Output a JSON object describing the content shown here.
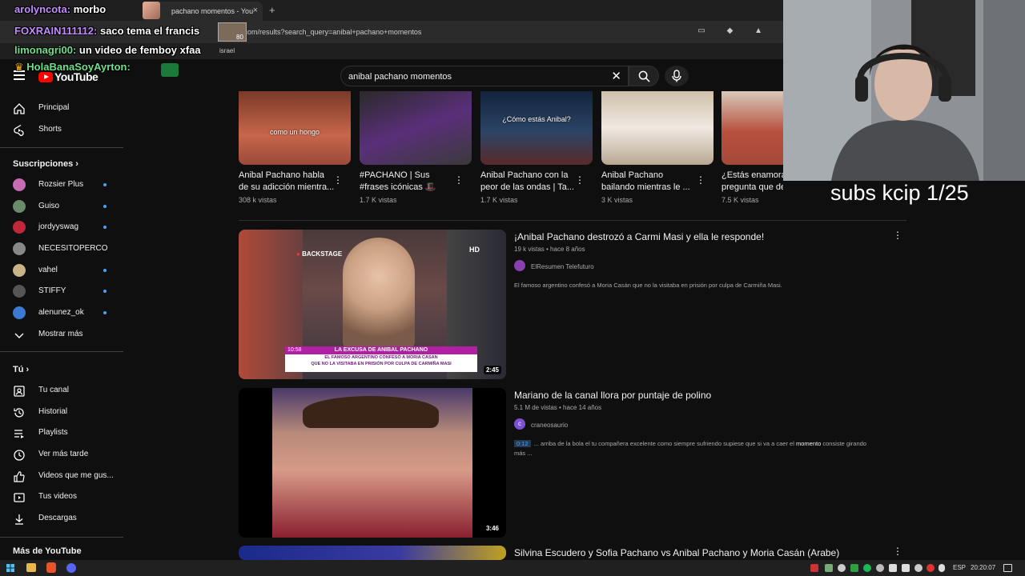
{
  "browser": {
    "tab_title": "pachano momentos - You",
    "tab_close": "×",
    "new_tab": "+",
    "url": ".com/results?search_query=anibal+pachano+momentos",
    "bookmark_label": "israel",
    "addr_icons": "▭ ◆ ▲"
  },
  "chat": {
    "line1_user": "arolyncota:",
    "line1_msg": "morbo",
    "line2_user": "FOXRAIN111112:",
    "line2_msg": "saco tema el francis",
    "line3_user": "limonagri00:",
    "line3_msg": "un video de femboy xfaa",
    "line4_user": "HolaBanaSoyAyrton:",
    "badge_count": "80"
  },
  "search": {
    "query": "anibal pachano momentos",
    "clear": "✕"
  },
  "logo": {
    "text": "YouTube"
  },
  "sidebar": {
    "main": [
      {
        "label": "Principal",
        "icon": "home-icon"
      },
      {
        "label": "Shorts",
        "icon": "shorts-icon"
      }
    ],
    "subs_heading": "Suscripciones",
    "subs": [
      {
        "label": "Rozsier Plus",
        "color": "#c76bb3",
        "dot": true
      },
      {
        "label": "Guiso",
        "color": "#6a8a6a",
        "dot": true
      },
      {
        "label": "jordyyswag",
        "color": "#c0273a",
        "dot": true
      },
      {
        "label": "NECESITOPERCO",
        "color": "#888888",
        "dot": false
      },
      {
        "label": "vahel",
        "color": "#c9b48a",
        "dot": true
      },
      {
        "label": "STIFFY",
        "color": "#555555",
        "dot": true
      },
      {
        "label": "alenunez_ok",
        "color": "#3a7ad1",
        "dot": true
      }
    ],
    "show_more": "Mostrar más",
    "you_heading": "Tú",
    "you": [
      {
        "label": "Tu canal",
        "icon": "channel-icon"
      },
      {
        "label": "Historial",
        "icon": "history-icon"
      },
      {
        "label": "Playlists",
        "icon": "playlists-icon"
      },
      {
        "label": "Ver más tarde",
        "icon": "watch-later-icon"
      },
      {
        "label": "Videos que me gus...",
        "icon": "like-icon"
      },
      {
        "label": "Tus videos",
        "icon": "your-videos-icon"
      },
      {
        "label": "Descargas",
        "icon": "download-icon"
      }
    ],
    "more_heading": "Más de YouTube"
  },
  "shorts": [
    {
      "title": "Anibal Pachano habla de su adicción mientra...",
      "views": "308 k vistas",
      "caption": "como un hongo",
      "bg": "#a5563d"
    },
    {
      "title": "#PACHANO | Sus #frases icónicas 🎩",
      "views": "1.7 K vistas",
      "caption": "",
      "bg": "#6b3a8f"
    },
    {
      "title": "Anibal Pachano con la peor de las ondas | Ta...",
      "views": "1.7 K vistas",
      "caption": "¿Cómo estás Anibal?",
      "bg": "#1f3a5a"
    },
    {
      "title": "Anibal Pachano bailando mientras le ...",
      "views": "3 K vistas",
      "caption": "",
      "bg": "#c9b49a"
    },
    {
      "title": "¿Estás enamorado? pregunta que descolo...",
      "views": "7.5 K vistas",
      "caption": "",
      "bg": "#b04a3a"
    }
  ],
  "results": [
    {
      "title": "¡Anibal Pachano destrozó a Carmi Masi y ella le responde!",
      "meta": "19 k vistas • hace 8 años",
      "channel": "ElResumen Telefuturo",
      "channel_color": "#8a3fb0",
      "desc": "El famoso argentino confesó a Moria Casán que no la visitaba en prisión por culpa de Carmiña Masi.",
      "duration": "2:45",
      "overlay_line1": "LA EXCUSA DE ANIBAL PACHANO",
      "overlay_line2": "EL FAMOSO ARGENTINO CONFESÓ A MORIA CASAN",
      "overlay_line3": "QUE NO LA VISITABA EN PRISIÓN POR CULPA DE CARMIÑA MASI",
      "overlay_time": "10:58",
      "overlay_rec": "BACKSTAGE",
      "overlay_hd": "HD"
    },
    {
      "title": "Mariano de la canal llora por puntaje de polino",
      "meta": "5.1 M de vistas • hace 14 años",
      "channel": "craneosaurio",
      "channel_color": "#7b4fd6",
      "channel_initial": "c",
      "desc_ts": "0:12",
      "desc_a": "... arriba de la bola el tu compañera excelente como siempre sufriendo supiese que si va a caer el",
      "desc_kw": "momento",
      "desc_b": "consiste girando más ...",
      "duration": "3:46"
    },
    {
      "title": "Silvina Escudero y Sofia Pachano vs Anibal Pachano y Moria Casán (Arabe)"
    }
  ],
  "overlay": {
    "subs_text": "subs kcip 1/25"
  },
  "taskbar": {
    "lang": "ESP",
    "time": "20:20:07"
  }
}
